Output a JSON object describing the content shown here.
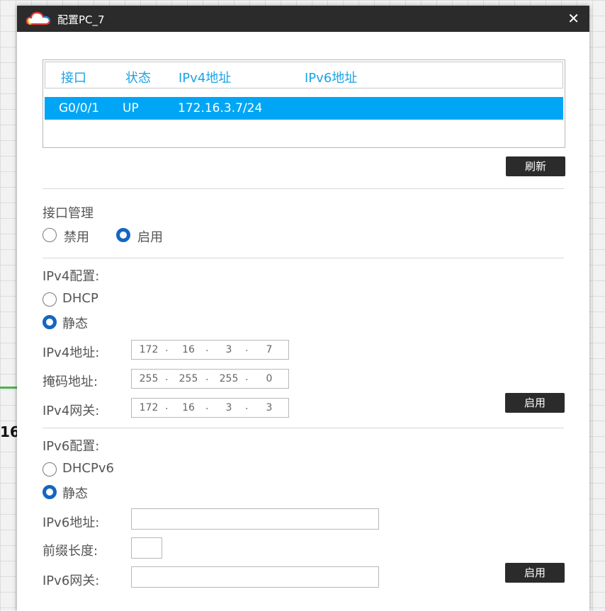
{
  "window": {
    "title": "配置PC_7"
  },
  "background": {
    "partial_text": "16"
  },
  "interfaces": {
    "headers": [
      "接口",
      "状态",
      "IPv4地址",
      "IPv6地址"
    ],
    "rows": [
      {
        "interface": "G0/0/1",
        "status": "UP",
        "ipv4": "172.16.3.7/24",
        "ipv6": ""
      }
    ]
  },
  "refresh_label": "刷新",
  "interface_mgmt": {
    "title": "接口管理",
    "disable_label": "禁用",
    "enable_label": "启用",
    "selected": "enable"
  },
  "ipv4": {
    "title": "IPv4配置:",
    "dhcp_label": "DHCP",
    "static_label": "静态",
    "mode": "static",
    "address_label": "IPv4地址:",
    "address": [
      "172",
      "16",
      "3",
      "7"
    ],
    "mask_label": "掩码地址:",
    "mask": [
      "255",
      "255",
      "255",
      "0"
    ],
    "gateway_label": "IPv4网关:",
    "gateway": [
      "172",
      "16",
      "3",
      "3"
    ],
    "apply_label": "启用"
  },
  "ipv6": {
    "title": "IPv6配置:",
    "dhcp_label": "DHCPv6",
    "static_label": "静态",
    "mode": "static",
    "address_label": "IPv6地址:",
    "address": "",
    "prefix_label": "前缀长度:",
    "prefix": "",
    "gateway_label": "IPv6网关:",
    "gateway": "",
    "apply_label": "启用"
  },
  "colors": {
    "titlebar": "#2b2b2b",
    "header_text": "#1aa3e8",
    "selected_row": "#00a6f5",
    "radio_selected": "#1566c0"
  },
  "icons": {
    "app": "cloud-icon",
    "close": "close-icon"
  }
}
